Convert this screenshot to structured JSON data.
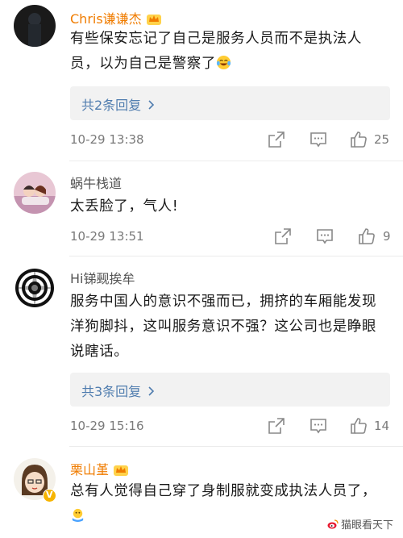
{
  "comments": [
    {
      "username": "Chris谦谦杰",
      "text": "有些保安忘记了自己是服务人员而不是执法人员，以为自己是警察了",
      "emoji": "laughing-crying-emoji",
      "replies": "共2条回复",
      "time": "10-29 13:38",
      "likes": "25"
    },
    {
      "username": "蜗牛栈道",
      "text": "太丢脸了，气人!",
      "time": "10-29 13:51",
      "likes": "9"
    },
    {
      "username": "Hi锑觋挨牟",
      "text": "服务中国人的意识不强而已，拥挤的车厢能发现洋狗脚抖，这叫服务意识不强？这公司也是睁眼说瞎话。",
      "replies": "共3条回复",
      "time": "10-29 15:16",
      "likes": "14"
    },
    {
      "username": "栗山堇",
      "text": "总有人觉得自己穿了身制服就变成执法人员了，",
      "emoji": "hand-clap-emoji"
    }
  ],
  "watermark": "猫眼看天下",
  "colors": {
    "vip_name": "#f07c00",
    "link": "#507daf",
    "reply_bg": "#f2f2f2"
  },
  "icons": {
    "share": "share-icon",
    "comment": "comment-icon",
    "like": "thumbs-up-icon"
  }
}
